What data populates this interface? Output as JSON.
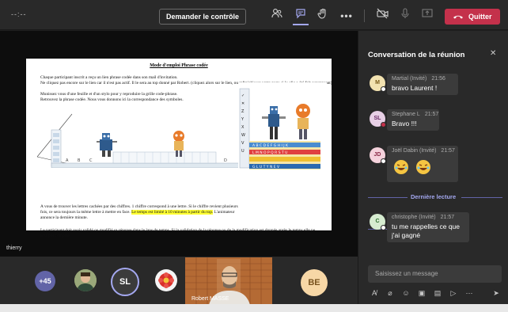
{
  "topbar": {
    "timer": "--:--",
    "control_button": "Demander le contrôle",
    "quit_button": "Quitter"
  },
  "slide": {
    "title": "Mode d'emploi Phrase codée",
    "para1": "Chaque participant inscrit a reçu un lien phrase codée dans son mail d'invitation.",
    "para2": "Ne cliquez pas encore sur le lien car il n'est pas actif. Il le sera au top donné par Robert. (cliquez alors sur le lien, ou rafraichissez votre page si le clic a été fait auparavant)",
    "para3": "Munissez vous d'une feuille et d'un stylo pour y reproduire la grille code-phrase.",
    "para4": "Retrouvez la phrase codée. Nous vous donnons ici la correspondance des symboles.",
    "para5_a": "A vous de trouver les lettres cachées par des chiffres. 1 chiffre correspond à une lettre. Si le chiffre revient plusieurs fois, ce sera toujours la même lettre à mettre en face. ",
    "para5_highlight": "Le temps est limité à 10 minutes à partir du top.",
    "para5_b": " L'animateur annonce la dernière minute.",
    "para6": "Le participant doit avoir validé ou modifié sa réponse dans le laps de temps. Si la validation de la réponse ou de la modification est donnée après le temps elle ne sera pas comptée."
  },
  "stage": {
    "speaker_label": "thierry"
  },
  "gallery": {
    "overflow_count": "+45",
    "sl_initials": "SL",
    "be_initials": "BE",
    "video_name": "Robert MASSE"
  },
  "chat": {
    "title": "Conversation de la réunion",
    "divider": "Dernière lecture",
    "compose_placeholder": "Saisissez un message",
    "messages": [
      {
        "initials": "M",
        "author": "Martial (Invité)",
        "time": "21:56",
        "text": "bravo Laurent !"
      },
      {
        "initials": "SL",
        "author": "Stephane L",
        "time": "21:57",
        "text": "Bravo !!!"
      },
      {
        "initials": "JD",
        "author": "Joël Dabin (Invité)",
        "time": "21:57",
        "text": ""
      },
      {
        "initials": "C",
        "author": "christophe (Invité)",
        "time": "21:57",
        "text": "tu me rappelles ce que j'ai gagné"
      }
    ]
  },
  "colors": {
    "accent": "#6264a7",
    "quit": "#c4314b",
    "highlight": "#ffff33"
  }
}
